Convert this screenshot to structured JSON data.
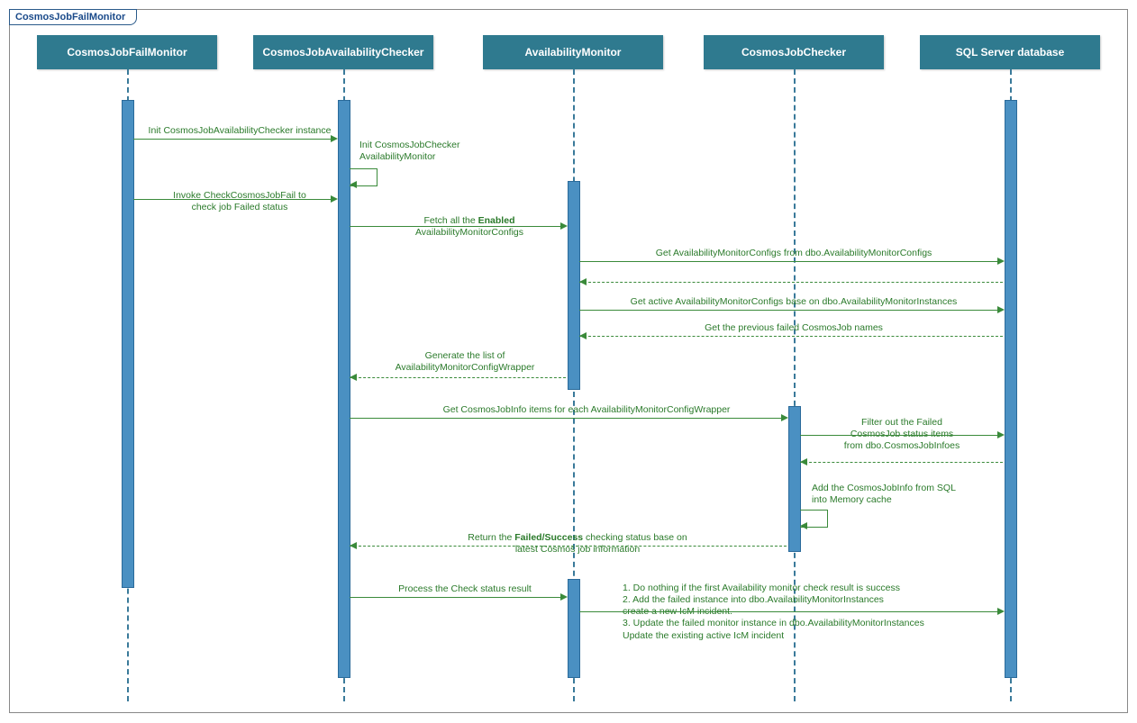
{
  "frame_title": "CosmosJobFailMonitor",
  "participants": {
    "p1": "CosmosJobFailMonitor",
    "p2": "CosmosJobAvailabilityChecker",
    "p3": "AvailabilityMonitor",
    "p4": "CosmosJobChecker",
    "p5": "SQL Server database"
  },
  "messages": {
    "m1": "Init CosmosJobAvailabilityChecker instance",
    "m2a": "Init CosmosJobChecker",
    "m2b": "AvailabilityMonitor",
    "m3a": "Invoke CheckCosmosJobFail to",
    "m3b": "check job Failed status",
    "m4a": "Fetch all the ",
    "m4b": "Enabled",
    "m4c": "AvailabilityMonitorConfigs",
    "m5": "Get AvailabilityMonitorConfigs from dbo.AvailabilityMonitorConfigs",
    "m6": "Get active AvailabilityMonitorConfigs base on dbo.AvailabilityMonitorInstances",
    "m7": "Get the previous failed CosmosJob names",
    "m8a": "Generate the list of",
    "m8b": "AvailabilityMonitorConfigWrapper",
    "m9": "Get CosmosJobInfo items for each AvailabilityMonitorConfigWrapper",
    "m10a": "Filter out the Failed",
    "m10b": "CosmosJob status items",
    "m10c": "from dbo.CosmosJobInfoes",
    "m11a": "Add the CosmosJobInfo from SQL",
    "m11b": "into Memory cache",
    "m12a": "Return the ",
    "m12b": "Failed/Success",
    "m12c": " checking status base on",
    "m12d": "latest Cosmos job information",
    "m13": "Process the Check status result",
    "m14a": "1. Do nothing if the first Availability monitor check result is success",
    "m14b": "2. Add the failed instance into dbo.AvailabilityMonitorInstances",
    "m14c": "    create a new IcM incident.",
    "m14d": "3. Update the failed monitor instance in dbo.AvailabilityMonitorInstances",
    "m14e": "    Update the existing active IcM incident"
  }
}
